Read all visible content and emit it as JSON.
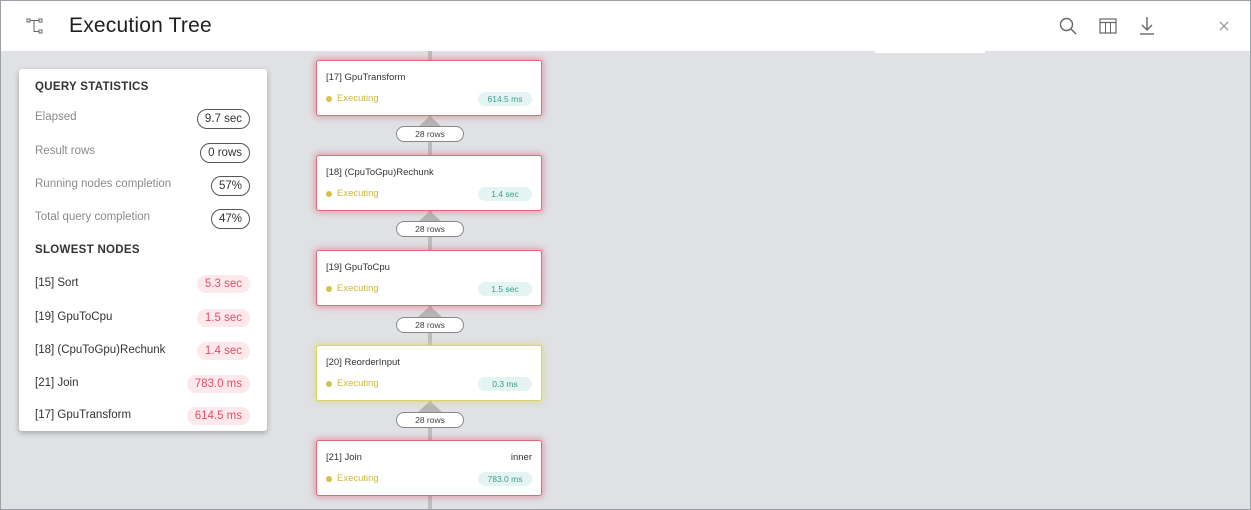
{
  "header": {
    "title": "Execution Tree",
    "icons": [
      "execution-tree-icon",
      "search-icon",
      "columns-icon",
      "download-icon",
      "close-icon"
    ]
  },
  "query_statistics": {
    "title": "QUERY STATISTICS",
    "rows": [
      {
        "label": "Elapsed",
        "value": "9.7 sec"
      },
      {
        "label": "Result rows",
        "value": "0 rows"
      },
      {
        "label": "Running nodes completion",
        "value": "57%"
      },
      {
        "label": "Total query completion",
        "value": "47%"
      }
    ]
  },
  "slowest_nodes": {
    "title": "SLOWEST NODES",
    "rows": [
      {
        "label": "[15] Sort",
        "value": "5.3 sec"
      },
      {
        "label": "[19] GpuToCpu",
        "value": "1.5 sec"
      },
      {
        "label": "[18] (CpuToGpu)Rechunk",
        "value": "1.4 sec"
      },
      {
        "label": "[21] Join",
        "value": "783.0 ms"
      },
      {
        "label": "[17] GpuTransform",
        "value": "614.5 ms"
      }
    ]
  },
  "nodes": [
    {
      "name": "[17] GpuTransform",
      "extra": "",
      "status": "Executing",
      "time": "614.5 ms",
      "highlight": "red"
    },
    {
      "name": "[18] (CpuToGpu)Rechunk",
      "extra": "",
      "status": "Executing",
      "time": "1.4 sec",
      "highlight": "red"
    },
    {
      "name": "[19] GpuToCpu",
      "extra": "",
      "status": "Executing",
      "time": "1.5 sec",
      "highlight": "red"
    },
    {
      "name": "[20] ReorderInput",
      "extra": "",
      "status": "Executing",
      "time": "0.3 ms",
      "highlight": "yellow"
    },
    {
      "name": "[21] Join",
      "extra": "inner",
      "status": "Executing",
      "time": "783.0 ms",
      "highlight": "red"
    }
  ],
  "edges": [
    {
      "rows": "28 rows"
    },
    {
      "rows": "28 rows"
    },
    {
      "rows": "28 rows"
    },
    {
      "rows": "28 rows"
    }
  ],
  "colors": {
    "canvas": "#dfe1e4",
    "node_red_border": "#e06b7a",
    "node_yellow_border": "#d9d36a",
    "status_yellow": "#cbb93f",
    "time_pill_text": "#3c9c8e",
    "slow_pill_text": "#e0506b"
  }
}
